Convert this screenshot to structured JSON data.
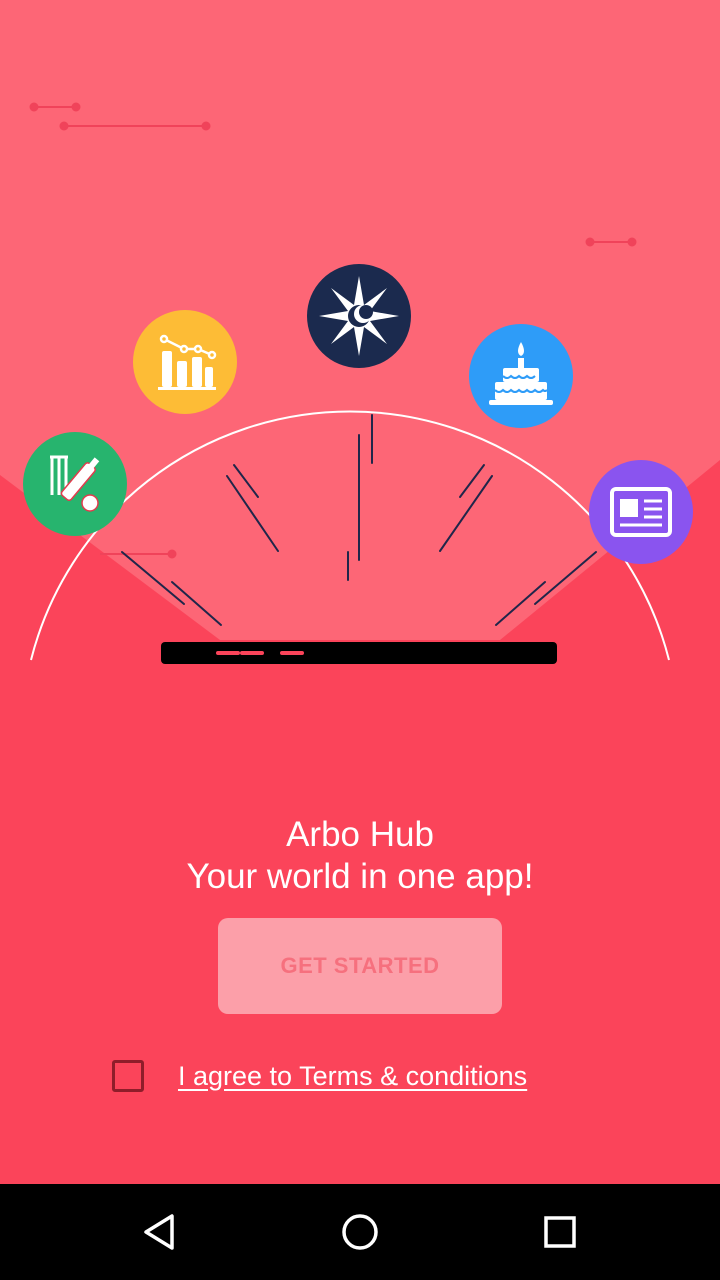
{
  "app": {
    "name": "Arbo Hub",
    "tagline": "Your world in one app!"
  },
  "hero": {
    "icons": [
      {
        "name": "cricket-icon",
        "color": "#27b46e"
      },
      {
        "name": "stats-chart-icon",
        "color": "#fdbc36"
      },
      {
        "name": "compass-moon-icon",
        "color": "#1b2a4e"
      },
      {
        "name": "birthday-cake-icon",
        "color": "#2e9cf8"
      },
      {
        "name": "newspaper-icon",
        "color": "#8a54ef"
      }
    ]
  },
  "actions": {
    "get_started_label": "GET STARTED",
    "terms_label": "I agree to Terms & conditions",
    "terms_checked": false
  },
  "colors": {
    "background_top": "#fd6676",
    "background_bottom": "#fb445a",
    "button_fill": "#fc9fa9",
    "button_text": "#f6707e",
    "checkbox_border": "#8f1d2a"
  },
  "navbar": {
    "back_icon": "back-triangle-icon",
    "home_icon": "home-circle-icon",
    "recents_icon": "recents-square-icon"
  }
}
